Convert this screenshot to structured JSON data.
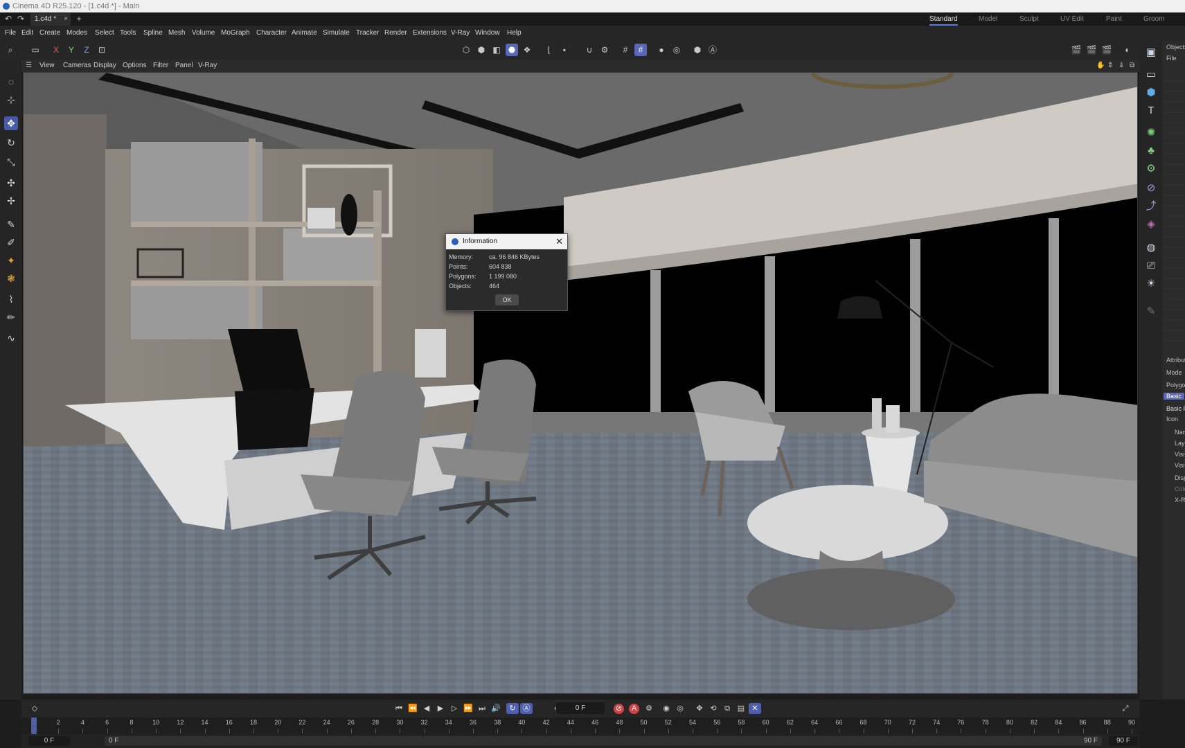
{
  "window": {
    "title": "Cinema 4D R25.120 - [1.c4d *] - Main"
  },
  "tabs": {
    "document": "1.c4d *",
    "close": "×",
    "add": "+",
    "undo": "↶",
    "redo": "↷"
  },
  "layouts": [
    "Standard",
    "Model",
    "Sculpt",
    "UV Edit",
    "Paint",
    "Groom"
  ],
  "menu": [
    "File",
    "Edit",
    "Create",
    "Modes",
    "Select",
    "Tools",
    "Spline",
    "Mesh",
    "Volume",
    "MoGraph",
    "Character",
    "Animate",
    "Simulate",
    "Tracker",
    "Render",
    "Extensions",
    "V-Ray",
    "Window",
    "Help"
  ],
  "axes": {
    "x": "X",
    "y": "Y",
    "z": "Z"
  },
  "viewport_menu": [
    "View",
    "Cameras",
    "Display",
    "Options",
    "Filter",
    "Panel",
    "V-Ray"
  ],
  "dialog": {
    "title": "Information",
    "close": "✕",
    "rows": [
      {
        "label": "Memory:",
        "value": "ca. 96 846 KBytes"
      },
      {
        "label": "Points:",
        "value": "604 838"
      },
      {
        "label": "Polygons:",
        "value": "1 199 080"
      },
      {
        "label": "Objects:",
        "value": "464"
      }
    ],
    "ok": "OK"
  },
  "right_panel": {
    "objects": "Objects",
    "file": "File",
    "attributes": "Attributes",
    "mode": "Mode",
    "poly": "Polygon",
    "basic_tab": "Basic",
    "basic_props": "Basic Properties",
    "icon": "Icon",
    "name": "Name",
    "layer": "Layer",
    "vis1": "Visible",
    "vis2": "Visible",
    "display": "Display",
    "color": "Color",
    "xray": "X-Ray"
  },
  "timeline": {
    "current_frame": "0 F",
    "ruler": [
      "0",
      "2",
      "4",
      "6",
      "8",
      "10",
      "12",
      "14",
      "16",
      "18",
      "20",
      "22",
      "24",
      "26",
      "28",
      "30",
      "32",
      "34",
      "36",
      "38",
      "40",
      "42",
      "44",
      "46",
      "48",
      "50",
      "52",
      "54",
      "56",
      "58",
      "60",
      "62",
      "64",
      "66",
      "68",
      "70",
      "72",
      "74",
      "76",
      "78",
      "80",
      "82",
      "84",
      "86",
      "88",
      "90"
    ],
    "range_start": "0 F",
    "range_min": "0 F",
    "range_max": "90 F",
    "range_end": "90 F"
  },
  "colors": {
    "accent": "#5967b8",
    "ui_bg": "#262626",
    "dialog_header": "#f2f2f2"
  }
}
